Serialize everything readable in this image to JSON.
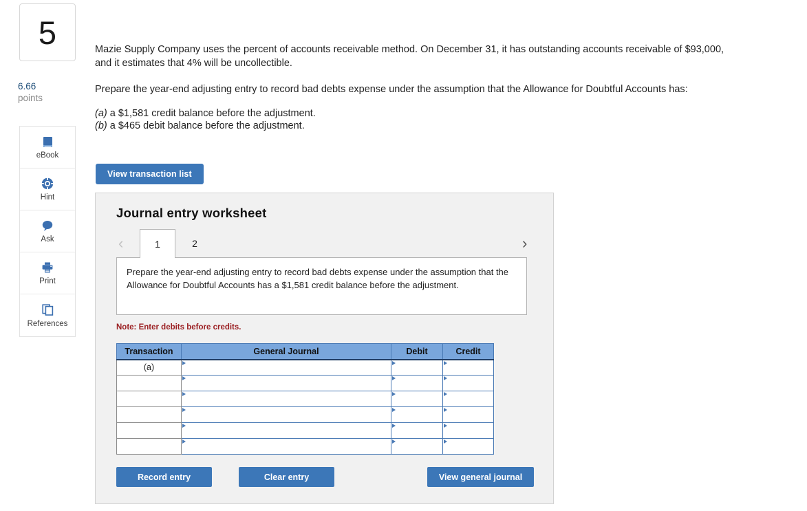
{
  "question": {
    "number": "5",
    "points_value": "6.66",
    "points_label": "points",
    "paragraph_1": "Mazie Supply Company uses the percent of accounts receivable method. On December 31, it has outstanding accounts receivable of $93,000, and it estimates that 4% will be uncollectible.",
    "paragraph_2": "Prepare the year-end adjusting entry to record bad debts expense under the assumption that the Allowance for Doubtful Accounts has:",
    "option_a_marker": "(a)",
    "option_a_text": " a $1,581 credit balance before the adjustment.",
    "option_b_marker": "(b)",
    "option_b_text": " a $465 debit balance before the adjustment."
  },
  "tools": [
    {
      "label": "eBook",
      "icon": "book-icon"
    },
    {
      "label": "Hint",
      "icon": "life-ring-icon"
    },
    {
      "label": "Ask",
      "icon": "speech-bubble-icon"
    },
    {
      "label": "Print",
      "icon": "printer-icon"
    },
    {
      "label": "References",
      "icon": "copy-pages-icon"
    }
  ],
  "toolbar": {
    "view_transaction_list_label": "View transaction list"
  },
  "worksheet": {
    "title": "Journal entry worksheet",
    "prev_arrow": "‹",
    "next_arrow": "›",
    "tabs": [
      {
        "label": "1",
        "selected": true
      },
      {
        "label": "2",
        "selected": false
      }
    ],
    "prompt": "Prepare the year-end adjusting entry to record bad debts expense under the assumption that the Allowance for Doubtful Accounts has a $1,581 credit balance before the adjustment.",
    "note": "Note: Enter debits before credits.",
    "table": {
      "columns": [
        "Transaction",
        "General Journal",
        "Debit",
        "Credit"
      ],
      "rows": [
        {
          "transaction": "(a)",
          "general_journal": "",
          "debit": "",
          "credit": ""
        },
        {
          "transaction": "",
          "general_journal": "",
          "debit": "",
          "credit": ""
        },
        {
          "transaction": "",
          "general_journal": "",
          "debit": "",
          "credit": ""
        },
        {
          "transaction": "",
          "general_journal": "",
          "debit": "",
          "credit": ""
        },
        {
          "transaction": "",
          "general_journal": "",
          "debit": "",
          "credit": ""
        },
        {
          "transaction": "",
          "general_journal": "",
          "debit": "",
          "credit": ""
        }
      ]
    },
    "buttons": {
      "record_entry": "Record entry",
      "clear_entry": "Clear entry",
      "view_general_journal": "View general journal"
    }
  },
  "colors": {
    "button_blue": "#3c77b8",
    "table_header_blue": "#79a6dc",
    "note_red": "#9b2023",
    "points_blue": "#23527c",
    "panel_gray": "#f1f1f1"
  }
}
